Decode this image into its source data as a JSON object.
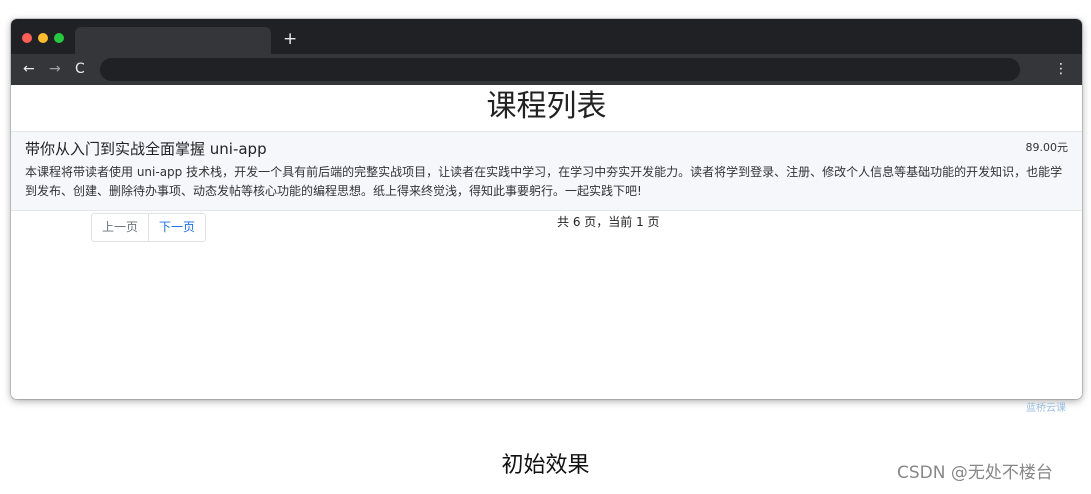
{
  "browser": {
    "new_tab": "+",
    "back": "←",
    "forward": "→",
    "reload": "C",
    "menu": "⋮"
  },
  "page": {
    "title": "课程列表"
  },
  "course": {
    "title": "带你从入门到实战全面掌握 uni-app",
    "price": "89.00元",
    "description": "本课程将带读者使用 uni-app 技术栈，开发一个具有前后端的完整实战项目，让读者在实践中学习，在学习中夯实开发能力。读者将学到登录、注册、修改个人信息等基础功能的开发知识，也能学到发布、创建、删除待办事项、动态发帖等核心功能的编程思想。纸上得来终觉浅，得知此事要躬行。一起实践下吧!"
  },
  "pagination": {
    "prev_label": "上一页",
    "next_label": "下一页",
    "info": "共 6 页，当前 1 页"
  },
  "caption": "初始效果",
  "watermark": {
    "logo_text": "蓝桥云课",
    "csdn": "CSDN @无处不楼台"
  }
}
